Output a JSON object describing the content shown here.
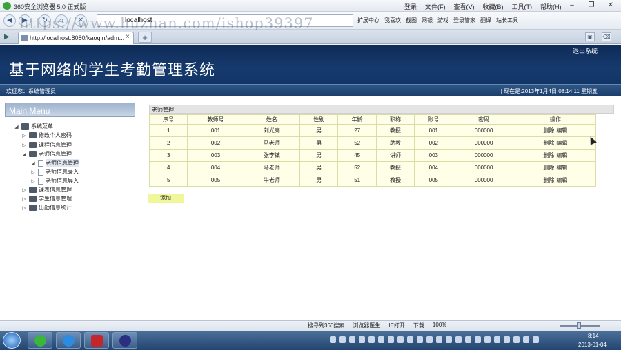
{
  "browser": {
    "title": "360安全浏览器 5.0 正式版",
    "menus": [
      "登录",
      "文件(F)",
      "查看(V)",
      "收藏(B)",
      "工具(T)",
      "帮助(H)"
    ],
    "window_controls": [
      "–",
      "❐",
      "✕"
    ],
    "nav_host": "localhost",
    "toolbar": [
      "扩展中心",
      "我喜欢",
      "截图",
      "网银",
      "游戏",
      "登录管家",
      "翻译",
      "站长工具"
    ],
    "tab_title": "http://localhost:8080/kaoqin/adm...",
    "tab_close": "×",
    "tab_new": "+",
    "status_items": [
      "搜寻到360搜索",
      "浏览器医生",
      "IE打开",
      "下载",
      "100%"
    ],
    "clock_time": "8:14",
    "clock_date": "2013-01-04"
  },
  "watermark": "https://www.huzhan.com/ishop39397",
  "header": {
    "title": "基于网络的学生考勤管理系统",
    "logout": "退出系统",
    "welcome": "欢迎您：系统管理员",
    "datetime": "| 现在是:2013年1月4日  08:14:11 星期五"
  },
  "sidebar": {
    "title": "Main Menu",
    "root": "系统菜单",
    "items": [
      {
        "label": "修改个人密码",
        "expanded": false
      },
      {
        "label": "课程信息管理",
        "expanded": false
      },
      {
        "label": "老师信息管理",
        "expanded": true
      },
      {
        "label": "老师信息管理",
        "child": true
      },
      {
        "label": "老师信息录入",
        "child": true
      },
      {
        "label": "老师信息导入",
        "child": true
      },
      {
        "label": "课表信息管理",
        "expanded": false
      },
      {
        "label": "学生信息管理",
        "expanded": false
      },
      {
        "label": "出勤信息统计",
        "expanded": false
      }
    ]
  },
  "main": {
    "panel_title": "老师管理",
    "columns": [
      "序号",
      "教师号",
      "姓名",
      "性别",
      "年龄",
      "职称",
      "账号",
      "密码",
      "操作"
    ],
    "rows": [
      [
        "1",
        "001",
        "刘光亮",
        "男",
        "27",
        "教授",
        "001",
        "000000"
      ],
      [
        "2",
        "002",
        "马老师",
        "男",
        "52",
        "助教",
        "002",
        "000000"
      ],
      [
        "3",
        "003",
        "张李镇",
        "男",
        "45",
        "讲师",
        "003",
        "000000"
      ],
      [
        "4",
        "004",
        "马老师",
        "男",
        "52",
        "教授",
        "004",
        "000000"
      ],
      [
        "5",
        "005",
        "牛老师",
        "男",
        "51",
        "教授",
        "005",
        "000000"
      ]
    ],
    "delete_label": "删除",
    "edit_label": "编辑",
    "add_label": "添加"
  }
}
